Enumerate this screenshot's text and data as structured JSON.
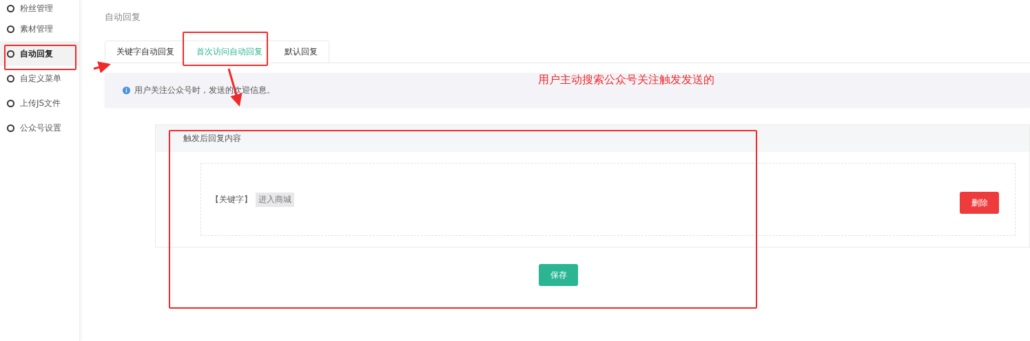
{
  "sidebar": {
    "items": [
      {
        "label": "粉丝管理",
        "selected": false
      },
      {
        "label": "素材管理",
        "selected": false
      },
      {
        "label": "自动回复",
        "selected": true
      },
      {
        "label": "自定义菜单",
        "selected": false
      },
      {
        "label": "上传JS文件",
        "selected": false
      },
      {
        "label": "公众号设置",
        "selected": false
      }
    ]
  },
  "page_title": "自动回复",
  "tabs": [
    {
      "label": "关键字自动回复",
      "selected": false
    },
    {
      "label": "首次访问自动回复",
      "selected": true
    },
    {
      "label": "默认回复",
      "selected": false
    }
  ],
  "info": "用户关注公众号时，发送的欢迎信息。",
  "card": {
    "title": "触发后回复内容",
    "keyword_label": "【关键字】",
    "keyword": "进入商城",
    "delete_button": "删除"
  },
  "save_button": "保存",
  "annotation": {
    "note": "用户主动搜索公众号关注触发发送的"
  }
}
